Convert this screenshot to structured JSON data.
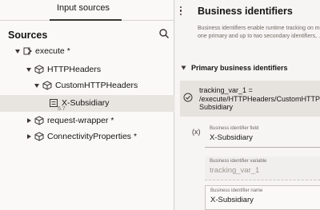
{
  "left": {
    "tab_label": "Input sources",
    "sources_title": "Sources",
    "tree": [
      {
        "label": "execute *",
        "state": "expanded",
        "icon": "operation-icon"
      },
      {
        "label": "HTTPHeaders",
        "state": "expanded",
        "icon": "cube-icon"
      },
      {
        "label": "CustomHTTPHeaders",
        "state": "expanded",
        "icon": "cube-icon"
      },
      {
        "label": "X-Subsidiary",
        "state": "leaf",
        "icon": "element-icon",
        "selected": true
      },
      {
        "label": "request-wrapper *",
        "state": "collapsed",
        "icon": "cube-icon"
      },
      {
        "label": "ConnectivityProperties *",
        "state": "collapsed",
        "icon": "cube-icon"
      }
    ],
    "cursor_hint": "5.7"
  },
  "right": {
    "title": "Business identifiers",
    "description": [
      "Business identifiers enable runtime tracking on me",
      "one primary and up to two secondary identifiers, ..."
    ],
    "section_title": "Primary business identifiers",
    "summary": [
      "tracking_var_1 =",
      "/execute/HTTPHeaders/CustomHTTPHe",
      "Subsidiary"
    ],
    "vars_icon_text": "(x)",
    "fields": {
      "identifier_field": {
        "label": "Business identifier field",
        "value": "X-Subsidiary"
      },
      "identifier_variable": {
        "label": "Business identifier variable",
        "value": "tracking_var_1"
      },
      "identifier_name": {
        "label": "Business identifier name",
        "value": "X-Subsidiary"
      }
    }
  },
  "colors": {
    "panel_bg": "#fbf9f8",
    "selected_bg": "#e8e5e1",
    "summary_bg": "#e6e3df",
    "text": "#161513",
    "muted_text": "#6f6a65"
  }
}
